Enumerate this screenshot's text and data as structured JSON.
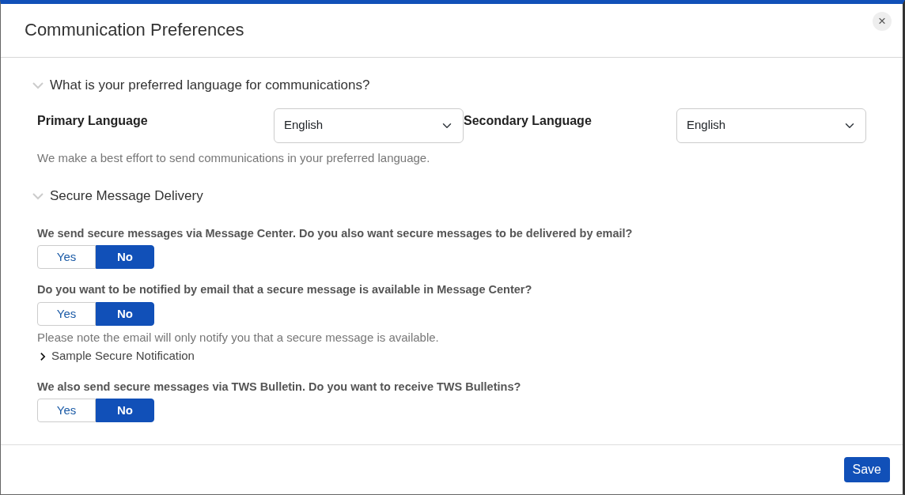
{
  "dialog": {
    "title": "Communication Preferences",
    "close": "×"
  },
  "sections": [
    {
      "heading": "What is your preferred language for communications?",
      "expanded": true,
      "kind": "languages",
      "fields": [
        {
          "label": "Primary Language",
          "value": "English"
        },
        {
          "label": "Secondary Language",
          "value": "English"
        }
      ],
      "note": "We make a best effort to send communications in your preferred language."
    },
    {
      "heading": "Secure Message Delivery",
      "expanded": true,
      "kind": "questions",
      "questions": [
        {
          "label": "We send secure messages via Message Center. Do you also want secure messages to be delivered by email?",
          "options": [
            {
              "label": "Yes",
              "selected": false
            },
            {
              "label": "No",
              "selected": true
            }
          ]
        },
        {
          "label": "Do you want to be notified by email that a secure message is available in Message Center?",
          "options": [
            {
              "label": "Yes",
              "selected": false
            },
            {
              "label": "No",
              "selected": true
            }
          ],
          "note": "Please note the email will only notify you that a secure message is available.",
          "link": {
            "label": "Sample Secure Notification",
            "expanded": false
          }
        },
        {
          "label": "We also send secure messages via TWS Bulletin. Do you want to receive TWS Bulletins?",
          "options": [
            {
              "label": "Yes",
              "selected": false
            },
            {
              "label": "No",
              "selected": true
            }
          ]
        }
      ]
    }
  ],
  "footer": {
    "save": "Save"
  }
}
